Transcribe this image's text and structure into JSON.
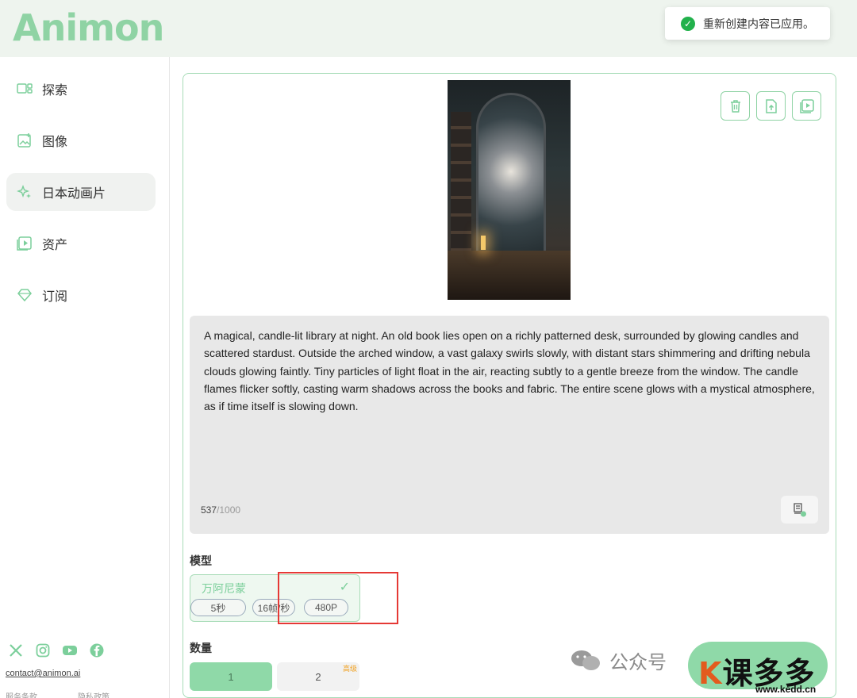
{
  "app": {
    "logo": "Animon"
  },
  "toast": {
    "text": "重新创建内容已应用。"
  },
  "sidebar": {
    "items": [
      {
        "label": "探索",
        "icon": "explore-icon"
      },
      {
        "label": "图像",
        "icon": "image-icon"
      },
      {
        "label": "日本动画片",
        "icon": "sparkle-icon",
        "active": true
      },
      {
        "label": "资产",
        "icon": "assets-icon"
      },
      {
        "label": "订阅",
        "icon": "diamond-icon"
      }
    ],
    "social": [
      "x-icon",
      "instagram-icon",
      "youtube-icon",
      "facebook-icon"
    ],
    "contact": "contact@animon.ai",
    "legal": [
      "服务条款",
      "隐私政策"
    ]
  },
  "main": {
    "prompt": "A magical, candle-lit library at night. An old book lies open on a richly patterned desk, surrounded by glowing candles and scattered stardust. Outside the arched window, a vast galaxy swirls slowly, with distant stars shimmering and drifting nebula clouds glowing faintly. Tiny particles of light float in the air, reacting subtly to a gentle breeze from the window. The candle flames flicker softly, casting warm shadows across the books and fabric. The entire scene glows with a mystical atmosphere, as if time itself is slowing down.",
    "char_count": "537",
    "char_max": "/1000",
    "model_label": "模型",
    "model": {
      "name": "万阿尼蒙",
      "check": "✓",
      "chips": [
        "5秒",
        "16帧/秒",
        "480P"
      ]
    },
    "quantity_label": "数量",
    "quantity_options": [
      "1",
      "2"
    ],
    "quantity_tag": "高级"
  },
  "watermark": {
    "text": "公众号",
    "logo_k": "K",
    "logo_text": "课多多",
    "url": "www.kedd.cn"
  },
  "colors": {
    "accent": "#8fd3a4",
    "accent_dark": "#7ccf9b",
    "highlight": "#e53935"
  }
}
